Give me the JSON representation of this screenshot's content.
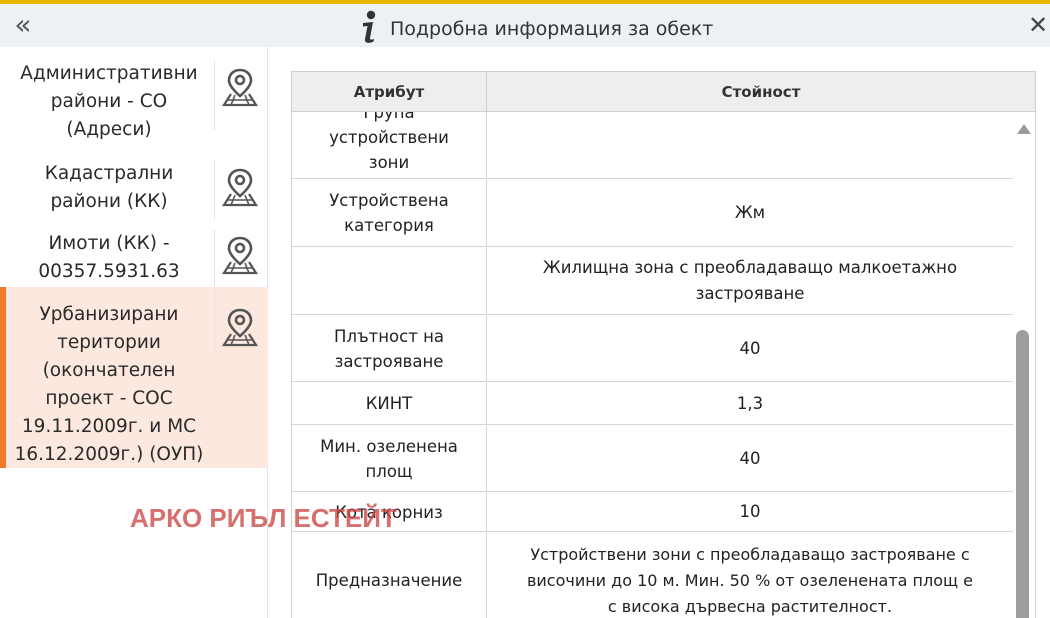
{
  "header": {
    "title": "Подробна информация за обект",
    "collapse_glyph": "«",
    "close_glyph": "✕",
    "icons": {
      "collapse": "double-chevron-left-icon",
      "info": "info-icon",
      "close": "close-icon"
    }
  },
  "sidebar": {
    "pin_icon": "map-pin-icon",
    "items": [
      {
        "label": "Административни\nрайони - СО\n(Адреси)",
        "active": false
      },
      {
        "label": "Кадастрални\nрайони (КК)",
        "active": false
      },
      {
        "label": "Имоти (КК) -\n00357.5931.63",
        "active": false
      },
      {
        "label": "Урбанизирани\nтеритории\n(окончателен\nпроект - СОС\n19.11.2009г. и МС\n16.12.2009г.) (ОУП)",
        "active": true
      }
    ]
  },
  "table": {
    "headers": {
      "attribute": "Атрибут",
      "value": "Стойност"
    },
    "rows": [
      {
        "attribute": "Група\nустройствени\nзони",
        "value": ""
      },
      {
        "attribute": "Устройствена\nкатегория",
        "value": "Жм"
      },
      {
        "attribute": "",
        "value": "Жилищна зона с преобладаващо малкоетажно\nзастрояване"
      },
      {
        "attribute": "Плътност на\nзастрояване",
        "value": "40"
      },
      {
        "attribute": "КИНТ",
        "value": "1,3"
      },
      {
        "attribute": "Мин. озеленена\nплощ",
        "value": "40"
      },
      {
        "attribute": "Кота корниз",
        "value": "10"
      },
      {
        "attribute": "Предназначение",
        "value": "Устройствени зони с преобладаващо застрояване с\nвисочини до 10 м. Мин. 50 % от озеленената площ е\nс висока дървесна растителност."
      }
    ]
  },
  "watermark": "АРКО РИЪЛ ЕСТЕЙТ",
  "colors": {
    "accent": "#f07828",
    "active_bg": "#fce8de",
    "header_bg": "#eef1f4",
    "watermark": "#cd4646"
  }
}
